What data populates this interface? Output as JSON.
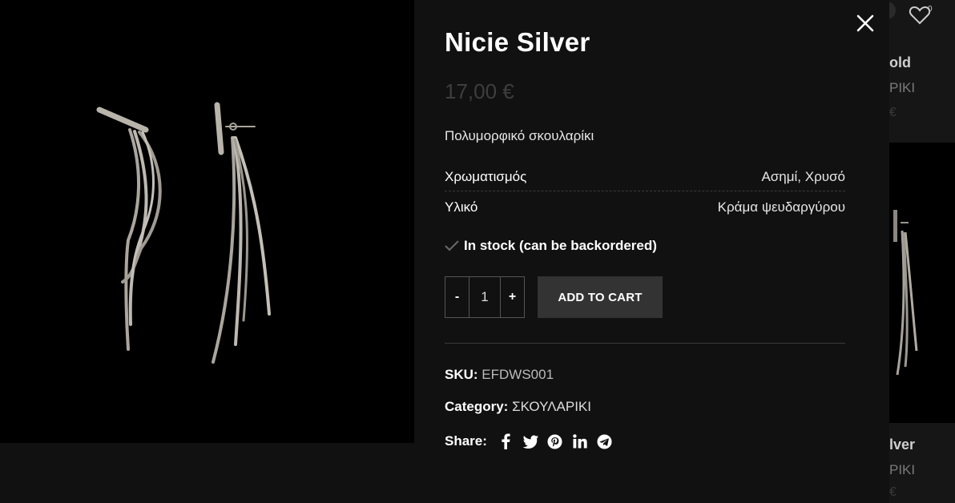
{
  "product": {
    "title": "Nicie Silver",
    "price": "17,00 €",
    "short_description": "Πολυμορφικό σκουλαρίκι",
    "attributes": [
      {
        "label": "Χρωματισμός",
        "value": "Ασημί, Χρυσό"
      },
      {
        "label": "Υλικό",
        "value": "Κράμα ψευδαργύρου"
      }
    ],
    "stock_status": "In stock (can be backordered)",
    "quantity": "1",
    "minus_label": "-",
    "plus_label": "+",
    "add_to_cart_label": "ADD TO CART",
    "sku_label": "SKU:",
    "sku_value": "EFDWS001",
    "category_label": "Category:",
    "category_value": "ΣΚΟΥΛΑΡΙΚΙ",
    "share_label": "Share:",
    "share_icons": [
      "facebook-icon",
      "twitter-icon",
      "pinterest-icon",
      "linkedin-icon",
      "telegram-icon"
    ]
  },
  "header": {
    "wishlist_count": "0"
  },
  "background_cards": [
    {
      "name": "old",
      "category": "ΡΙΚΙ",
      "price": "€"
    },
    {
      "name": "lver",
      "category": "ΡΙΚΙ",
      "price": "€"
    }
  ]
}
